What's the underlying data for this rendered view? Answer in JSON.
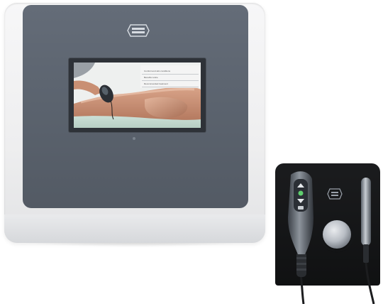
{
  "image": {
    "subject": "medical therapy device with touchscreen and handpiece stand",
    "background_color": "#ffffff"
  },
  "main_device": {
    "body_color": "#f0f0f1",
    "panel_color": "#5f6772",
    "logo_icon": "brand-badge-icon",
    "screen": {
      "menu_items": [
        "Comfort and skin conditions",
        "Benefits notice",
        "Recommended treatment"
      ],
      "photo_icon": "patient-treatment-photo"
    }
  },
  "handpiece_stand": {
    "stand_color": "#141516",
    "logo_icon": "brand-badge-icon",
    "handpiece_icon": "therapy-handpiece-icon",
    "probe_icon": "cylindrical-probe-icon",
    "button_icon": "round-metal-button-icon"
  }
}
